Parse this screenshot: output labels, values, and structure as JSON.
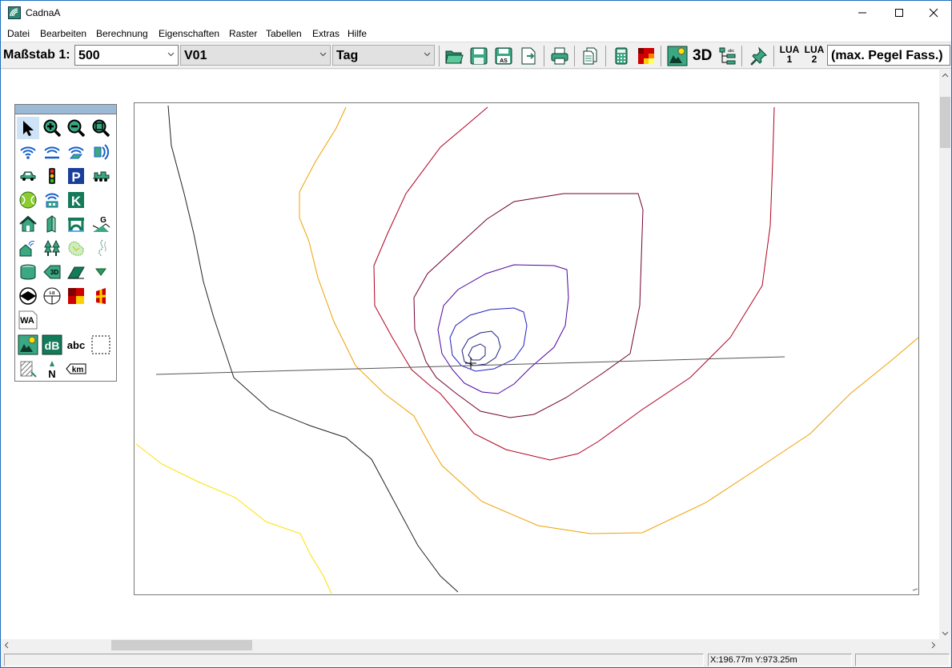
{
  "window": {
    "title": "CadnaA"
  },
  "menu": [
    "Datei",
    "Bearbeiten",
    "Berechnung",
    "Eigenschaften",
    "Raster",
    "Tabellen",
    "Extras",
    "Hilfe"
  ],
  "toolbar": {
    "scale_label": "Maßstab 1:",
    "scale_value": "500",
    "variant_value": "V01",
    "period_value": "Tag",
    "text_3d": "3D",
    "lua1_top": "LUA",
    "lua1_bottom": "1",
    "lua2_top": "LUA",
    "lua2_bottom": "2",
    "result_text": "(max. Pegel Fass.)"
  },
  "palette": {
    "wa_label": "WA",
    "db_label": "dB",
    "abc_label": "abc",
    "km_label": "km",
    "g_label": "G",
    "k_label": "K",
    "p_label": "P",
    "td_label": "3D"
  },
  "map": {
    "contour_colors": [
      "#222222",
      "#ffe000",
      "#f0a000",
      "#b00020",
      "#700030",
      "#5000a0",
      "#2020c0",
      "#202080"
    ]
  },
  "status": {
    "left": "",
    "coords": "X:196.77m Y:973.25m",
    "right": ""
  }
}
